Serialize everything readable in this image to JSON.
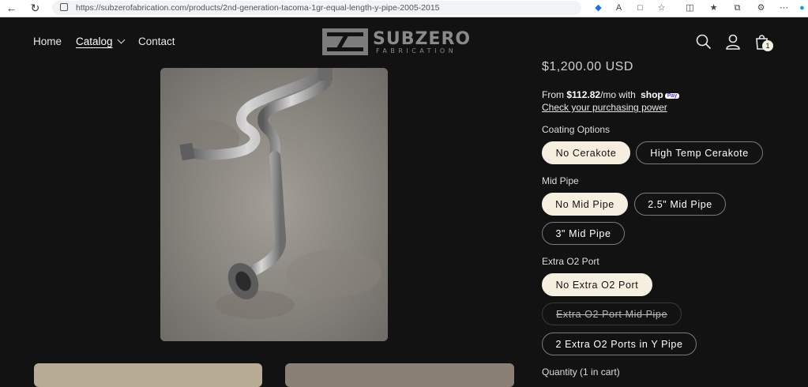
{
  "browser": {
    "url": "https://subzerofabrication.com/products/2nd-generation-tacoma-1gr-equal-length-y-pipe-2005-2015"
  },
  "header": {
    "nav": [
      {
        "label": "Home"
      },
      {
        "label": "Catalog"
      },
      {
        "label": "Contact"
      }
    ],
    "logo_word": "SUBZERO",
    "logo_sub": "FABRICATION",
    "cart_count": "1"
  },
  "product": {
    "price": "$1,200.00 USD",
    "installments_prefix": "From ",
    "installments_amount": "$112.82",
    "installments_suffix": "/mo with",
    "shop_word": "shop",
    "pay_word": "Pay",
    "purchasing_power_link": "Check your purchasing power",
    "options": [
      {
        "label": "Coating Options",
        "values": [
          {
            "label": "No Cerakote",
            "state": "selected"
          },
          {
            "label": "High Temp Cerakote",
            "state": "available"
          }
        ]
      },
      {
        "label": "Mid Pipe",
        "values": [
          {
            "label": "No Mid Pipe",
            "state": "selected"
          },
          {
            "label": "2.5\" Mid Pipe",
            "state": "available"
          },
          {
            "label": "3\" Mid Pipe",
            "state": "available"
          }
        ]
      },
      {
        "label": "Extra O2 Port",
        "values": [
          {
            "label": "No Extra O2 Port",
            "state": "selected"
          },
          {
            "label": "Extra O2 Port Mid Pipe",
            "state": "unavailable"
          },
          {
            "label": "2 Extra O2 Ports in Y Pipe",
            "state": "available"
          }
        ]
      }
    ],
    "quantity_label": "Quantity (1 in cart)"
  },
  "colors": {
    "background": "#121212",
    "selected_pill": "#f6efdf",
    "shop_pay": "#5a31f4"
  }
}
